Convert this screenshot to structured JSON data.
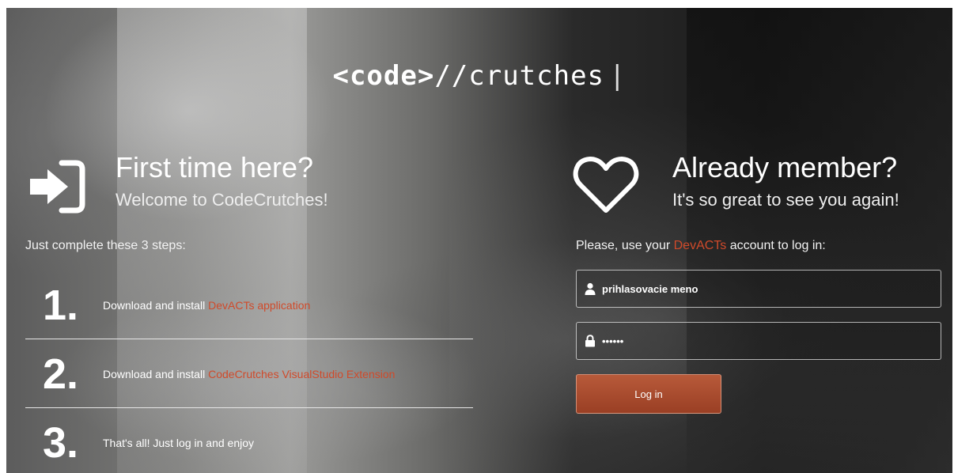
{
  "logo": {
    "bold": "<code>",
    "rest": "//crutches",
    "cursor": "|"
  },
  "left": {
    "title": "First time here?",
    "subtitle": "Welcome to CodeCrutches!",
    "intro": "Just complete these 3 steps:",
    "steps": [
      {
        "number": "1.",
        "text": "Download and install ",
        "link": "DevACTs application"
      },
      {
        "number": "2.",
        "text": "Download and install ",
        "link": "CodeCrutches VisualStudio Extension"
      },
      {
        "number": "3.",
        "text": "That's all! Just log in and enjoy",
        "link": ""
      }
    ]
  },
  "right": {
    "title": "Already member?",
    "subtitle": "It's so great to see you again!",
    "intro_before": "Please, use your ",
    "intro_link": "DevACTs",
    "intro_after": " account to log in:",
    "username_placeholder": "prihlasovacie meno",
    "password_value": "••••••",
    "login_button": "Log in"
  },
  "icons": {
    "enter": "sign-in-icon",
    "heart": "heart-icon",
    "user": "user-icon",
    "lock": "lock-icon"
  },
  "colors": {
    "link": "#d04a2a",
    "button": "#a84a2c"
  }
}
